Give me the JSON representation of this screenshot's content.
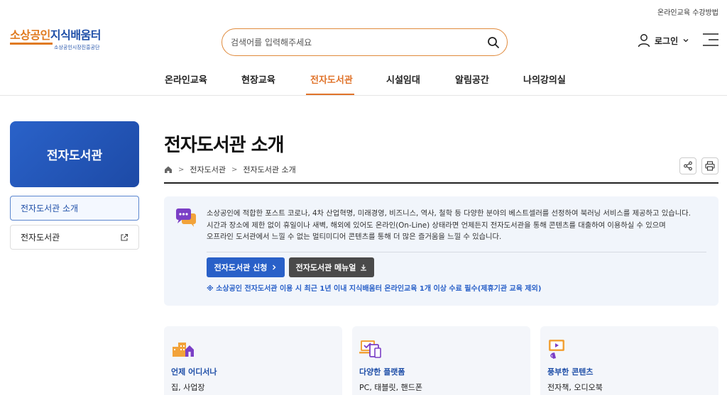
{
  "header": {
    "top_util_link": "온라인교육 수강방법",
    "logo_main_part1": "소상공인",
    "logo_main_part2": "지식배움터",
    "logo_sub": "소상공인시장진흥공단",
    "search_placeholder": "검색어를 입력해주세요",
    "login_label": "로그인"
  },
  "gnb": {
    "items": [
      {
        "label": "온라인교육"
      },
      {
        "label": "현장교육"
      },
      {
        "label": "전자도서관"
      },
      {
        "label": "시설임대"
      },
      {
        "label": "알림공간"
      },
      {
        "label": "나의강의실"
      }
    ]
  },
  "sidebar": {
    "title": "전자도서관",
    "items": [
      {
        "label": "전자도서관 소개"
      },
      {
        "label": "전자도서관"
      }
    ]
  },
  "content": {
    "title": "전자도서관 소개",
    "breadcrumb": [
      "전자도서관",
      "전자도서관 소개"
    ],
    "intro_lines": [
      "소상공인에 적합한 포스트 코로나, 4차 산업혁명, 미래경영, 비즈니스, 역사, 철학 등 다양한 분야의 베스트셀러를 선정하여 북러닝 서비스를 제공하고 있습니다.",
      "시간과 장소에 제한 없이 휴일이나 새벽, 해외에 있어도 온라인(On-Line) 상태라면 언제든지 전자도서관을 통해 콘텐츠를 대출하여 이용하실 수 있으며",
      "오프라인 도서관에서 느낄 수 없는 멀티미디어 콘텐츠를 통해 더 많은 즐거움을 느낄 수 있습니다."
    ],
    "apply_button": "전자도서관 신청",
    "manual_button": "전자도서관 메뉴얼",
    "note": "※ 소상공인 전자도서관 이용 시 최근 1년 이내 지식배움터 온라인교육 1개 이상 수료 필수(제휴기관 교육 제외)"
  },
  "cards": [
    {
      "title": "언제 어디서나",
      "desc": "집, 사업장",
      "icon": "buildings-icon"
    },
    {
      "title": "다양한 플랫폼",
      "desc": "PC, 태블릿, 핸드폰",
      "icon": "devices-icon"
    },
    {
      "title": "풍부한 콘텐츠",
      "desc": "전자책, 오디오북",
      "icon": "media-icon"
    }
  ],
  "colors": {
    "accent_orange": "#e0732a",
    "brand_blue": "#2960c8",
    "dark_button": "#4a4a4a"
  }
}
